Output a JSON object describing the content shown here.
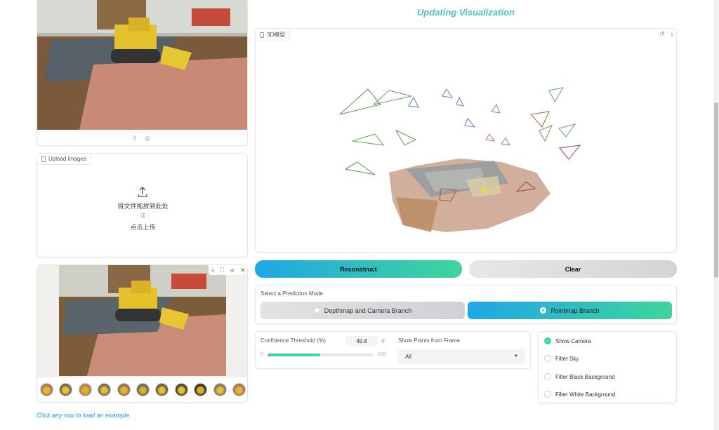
{
  "title": "Updating Visualization",
  "model3d": {
    "label": "3D模型"
  },
  "upload": {
    "label": "Upload Images",
    "drop_text": "将文件拖放到此处",
    "or_text": "- 或 -",
    "click_text": "点击上传"
  },
  "buttons": {
    "reconstruct": "Reconstruct",
    "clear": "Clear"
  },
  "prediction": {
    "label": "Select a Prediction Mode",
    "options": [
      "Depthmap and Camera Branch",
      "Pointmap Branch"
    ],
    "selected": "Pointmap Branch"
  },
  "confidence": {
    "label": "Confidence Threshold (%)",
    "value": "49.8",
    "min": "0",
    "max": "100",
    "fraction": 0.498
  },
  "frame": {
    "label": "Show Points from Frame",
    "value": "All"
  },
  "checks": [
    {
      "label": "Show Camera",
      "checked": true
    },
    {
      "label": "Filter Sky",
      "checked": false
    },
    {
      "label": "Filter Black Background",
      "checked": false
    },
    {
      "label": "Filter White Background",
      "checked": false
    }
  ],
  "examples_hint": "Click any row to load an example.",
  "colors": {
    "accent_start": "#1ea7e6",
    "accent_end": "#3fd59a",
    "title": "#4cc2c8",
    "link": "#1e9bd6"
  }
}
